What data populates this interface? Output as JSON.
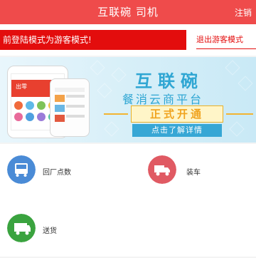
{
  "header": {
    "title": "互联碗 司机",
    "logout_label": "注销"
  },
  "notice": {
    "text": "前登陆模式为游客模式!",
    "exit_label": "退出游客模式"
  },
  "banner": {
    "title": "互联碗",
    "subtitle": "餐消云商平台",
    "badge": "正式开通",
    "cta": "点击了解详情",
    "phone_caption": "出零"
  },
  "tiles": [
    {
      "label": "回厂点数",
      "icon": "bus-icon",
      "color": "#4a8bd6"
    },
    {
      "label": "装车",
      "icon": "truck-icon",
      "color": "#e05a63"
    },
    {
      "label": "送货",
      "icon": "delivery-icon",
      "color": "#3aa33f"
    }
  ],
  "colors": {
    "primary": "#ef4b4b",
    "notice": "#e30d0d",
    "banner_text": "#2fa6d3"
  }
}
